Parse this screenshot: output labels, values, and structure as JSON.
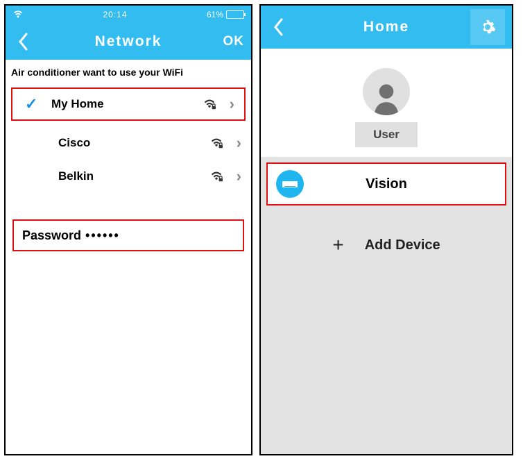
{
  "left": {
    "status": {
      "time": "20:14",
      "battery": "61%"
    },
    "nav": {
      "title": "Network",
      "ok": "OK"
    },
    "prompt": "Air conditioner want to use your WiFi",
    "networks": [
      {
        "name": "My Home",
        "selected": true
      },
      {
        "name": "Cisco",
        "selected": false
      },
      {
        "name": "Belkin",
        "selected": false
      }
    ],
    "password_label": "Password",
    "password_value": "••••••"
  },
  "right": {
    "nav": {
      "title": "Home"
    },
    "user_label": "User",
    "device_name": "Vision",
    "add_label": "Add Device"
  }
}
